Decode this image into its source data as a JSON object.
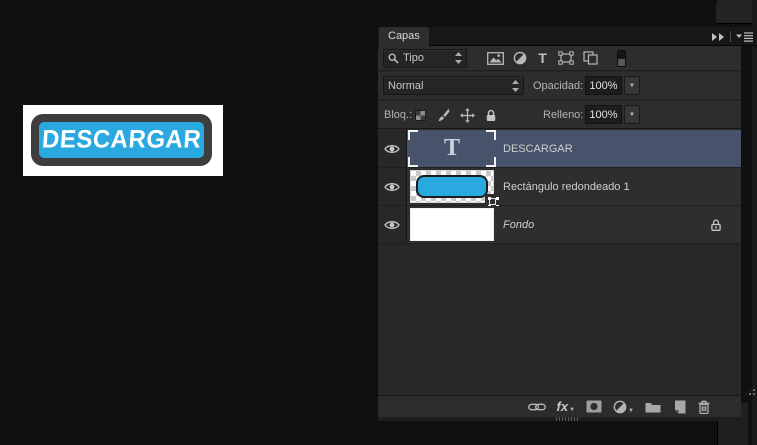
{
  "canvas": {
    "button_text": "DESCARGAR",
    "button_blue": "#29a9e0",
    "button_frame_gray": "#3d3d3d"
  },
  "panel": {
    "tab_label": "Capas",
    "header_icons": [
      "collapse-panels",
      "panel-menu"
    ],
    "filter": {
      "kind_value": "Tipo",
      "icons": [
        "pixel-layers-filter",
        "adjustment-layers-filter",
        "type-layers-filter",
        "shape-layers-filter",
        "smart-object-filter",
        "filter-toggle"
      ]
    },
    "blend": {
      "mode_value": "Normal",
      "opacity_label": "Opacidad:",
      "opacity_value": "100%"
    },
    "lock": {
      "label": "Bloq.:",
      "icons": [
        "lock-transparency",
        "lock-paint",
        "lock-position",
        "lock-all"
      ],
      "fill_label": "Relleno:",
      "fill_value": "100%"
    },
    "layers": [
      {
        "name": "DESCARGAR",
        "kind": "type",
        "thumb_glyph": "T",
        "visible": true,
        "selected": true
      },
      {
        "name": "Rectángulo redondeado 1",
        "kind": "shape",
        "visible": true,
        "selected": false
      },
      {
        "name": "Fondo",
        "kind": "background",
        "visible": true,
        "locked": true,
        "selected": false
      }
    ],
    "footer": {
      "fx_label": "fx",
      "icons": [
        "link-layers",
        "layer-styles-fx",
        "add-layer-mask",
        "new-adjustment-layer",
        "new-group",
        "new-layer",
        "delete-layer"
      ]
    },
    "colors": {
      "selected_row": "#46536a",
      "panel_bg": "#2d2d2d"
    }
  }
}
